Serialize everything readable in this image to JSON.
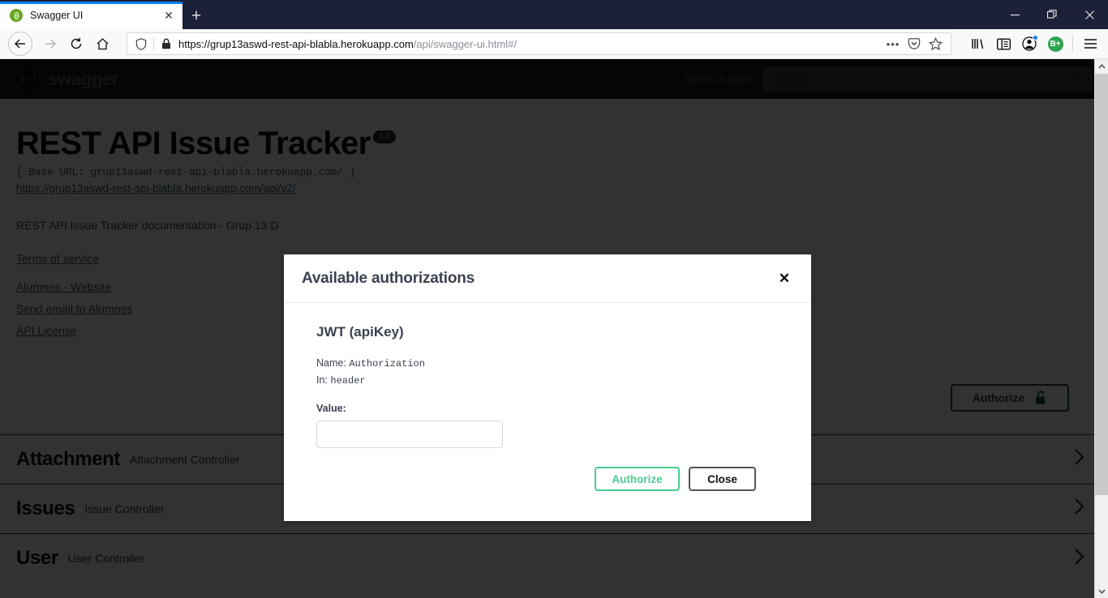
{
  "browser": {
    "tab": {
      "title": "Swagger UI",
      "favicon_name": "swagger-favicon",
      "close_label": "✕"
    },
    "newtab_label": "+",
    "window_controls": {
      "minimize": "—",
      "restore": "❐",
      "close": "✕"
    },
    "nav": {
      "back": "←",
      "forward": "→",
      "reload": "⟳",
      "home": "⌂"
    },
    "url": {
      "scheme_and_host": "https://grup13aswd-rest-api-blabla.herokuapp.com",
      "path": "/api/swagger-ui.html#/",
      "full": "https://grup13aswd-rest-api-blabla.herokuapp.com/api/swagger-ui.html#/"
    },
    "url_actions": {
      "more": "•••",
      "pocket": "pocket-icon",
      "bookmark": "star-icon"
    },
    "toolbar": {
      "library": "library-icon",
      "sidebar": "sidebar-icon",
      "account": "account-icon",
      "avatar_label": "B+",
      "menu": "☰"
    }
  },
  "swagger_topbar": {
    "logo_text": "swagger",
    "logo_mark": "{···}",
    "spec_label": "Select a spec",
    "spec_selected": "default",
    "spec_caret": "⌄"
  },
  "api_info": {
    "title": "REST API Issue Tracker",
    "version": "1.0",
    "base_url": "[ Base URL: grup13aswd-rest-api-blabla.herokuapp.com/ ]",
    "spec_url": "https://grup13aswd-rest-api-blabla.herokuapp.com/api/v2/",
    "description": "REST API Issue Tracker documentation - Grup 13 D",
    "links": [
      {
        "label": "Terms of service"
      },
      {
        "label": "Alumnes - Website"
      },
      {
        "label": "Send email to Alumnes"
      },
      {
        "label": "API License"
      }
    ]
  },
  "authorize_button": {
    "label": "Authorize",
    "icon": "unlock-icon"
  },
  "sections": [
    {
      "name": "Attachment",
      "description": "Attachment Controller",
      "chevron": "chevron-right-icon"
    },
    {
      "name": "Issues",
      "description": "Issue Controller",
      "chevron": "chevron-right-icon"
    },
    {
      "name": "User",
      "description": "User Controller",
      "chevron": "chevron-right-icon"
    }
  ],
  "modal": {
    "title": "Available authorizations",
    "close_icon": "✕",
    "scheme": {
      "name": "JWT",
      "kind": "(apiKey)",
      "name_label": "Name:",
      "name_value": "Authorization",
      "in_label": "In:",
      "in_value": "header"
    },
    "value_label": "Value:",
    "value_input": "",
    "value_placeholder": "",
    "buttons": {
      "authorize": "Authorize",
      "close": "Close"
    }
  },
  "scrollbar": {
    "up_arrow": "▲",
    "down_arrow": "▼"
  },
  "colors": {
    "swagger_green": "#49cc90",
    "topbar_dark": "#1b1b1b",
    "modal_title": "#3b4151",
    "link": "#31506b",
    "tab_accent": "#0a84ff",
    "titlebar": "#1c2038"
  }
}
